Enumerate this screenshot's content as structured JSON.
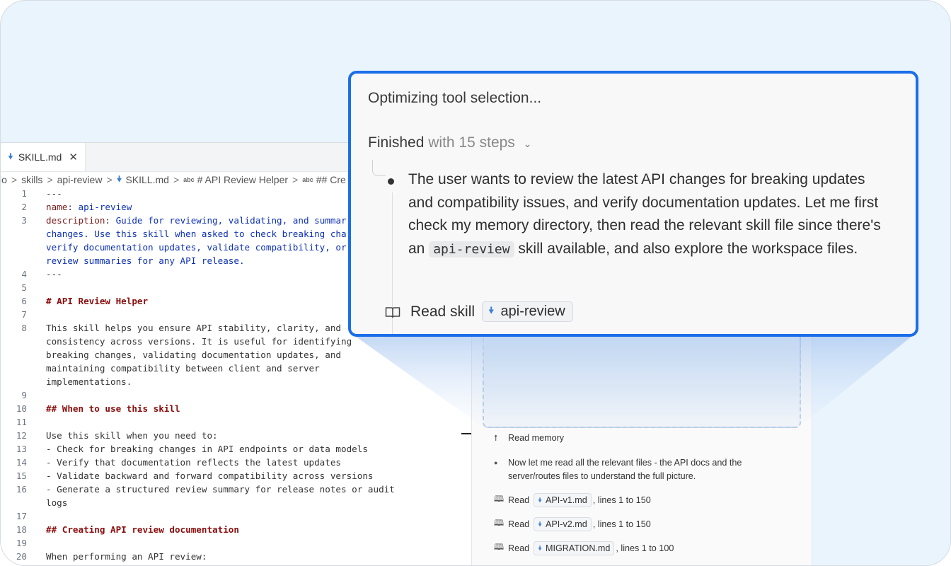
{
  "editor": {
    "tab_label": "SKILL.md",
    "tab_close": "✕",
    "breadcrumb": {
      "items": [
        "io",
        "skills",
        "api-review",
        "SKILL.md",
        "# API Review Helper",
        "## Cre"
      ],
      "sep": ">",
      "abc": "abc"
    },
    "lines": [
      {
        "n": "1",
        "t": "---"
      },
      {
        "n": "2",
        "k": "name",
        "v": "api-review"
      },
      {
        "n": "3",
        "k": "description",
        "v": "Guide for reviewing, validating, and summar"
      },
      {
        "n": "",
        "t": "changes. Use this skill when asked to check breaking cha",
        "cls": "c-blue"
      },
      {
        "n": "",
        "t": "verify documentation updates, validate compatibility, or",
        "cls": "c-blue"
      },
      {
        "n": "",
        "t": "review summaries for any API release.",
        "cls": "c-blue"
      },
      {
        "n": "4",
        "t": "---"
      },
      {
        "n": "5",
        "t": ""
      },
      {
        "n": "6",
        "t": "# API Review Helper",
        "cls": "c-head"
      },
      {
        "n": "7",
        "t": ""
      },
      {
        "n": "8",
        "t": "This skill helps you ensure API stability, clarity, and"
      },
      {
        "n": "",
        "t": "consistency across versions. It is useful for identifying"
      },
      {
        "n": "",
        "t": "breaking changes, validating documentation updates, and"
      },
      {
        "n": "",
        "t": "maintaining compatibility between client and server"
      },
      {
        "n": "",
        "t": "implementations."
      },
      {
        "n": "9",
        "t": ""
      },
      {
        "n": "10",
        "t": "## When to use this skill",
        "cls": "c-head"
      },
      {
        "n": "11",
        "t": ""
      },
      {
        "n": "12",
        "t": "Use this skill when you need to:"
      },
      {
        "n": "13",
        "t": "- Check for breaking changes in API endpoints or data models"
      },
      {
        "n": "14",
        "t": "- Verify that documentation reflects the latest updates"
      },
      {
        "n": "15",
        "t": "- Validate backward and forward compatibility across versions"
      },
      {
        "n": "16",
        "t": "- Generate a structured review summary for release notes or audit"
      },
      {
        "n": "",
        "t": "logs"
      },
      {
        "n": "17",
        "t": ""
      },
      {
        "n": "18",
        "t": "## Creating API review documentation",
        "cls": "c-head"
      },
      {
        "n": "19",
        "t": ""
      },
      {
        "n": "20",
        "t": "When performing an API review:"
      }
    ]
  },
  "chat_small": {
    "read_memory": "Read memory",
    "message": "Now let me read all the relevant files - the API docs and the",
    "message_2": "server/routes files to understand the full picture.",
    "read_label": "Read",
    "reads": [
      {
        "file": "API-v1.md",
        "range": ", lines 1 to 150"
      },
      {
        "file": "API-v2.md",
        "range": ", lines 1 to 150"
      },
      {
        "file": "MIGRATION.md",
        "range": ", lines 1 to 100"
      }
    ]
  },
  "popup": {
    "title": "Optimizing tool selection...",
    "finished": "Finished",
    "steps": "with 15 steps",
    "text_before": "The user wants to review the latest API changes for breaking updates and compatibility issues, and verify documentation updates. Let me first check my memory directory, then read the relevant skill file since there's an ",
    "inline_code": "api-review",
    "text_after": " skill available, and also explore the workspace files.",
    "read_skill": "Read skill",
    "skill_chip": "api-review"
  },
  "colors": {
    "accent": "#1b6ee8",
    "md_icon": "#3b7fd4",
    "yaml_value": "#0d31b5",
    "heading": "#8b0d0d",
    "background": "#eaf4fd"
  },
  "icons": [
    "markdown-file-icon",
    "close-icon",
    "chevron-down-icon",
    "book-icon",
    "memory-icon",
    "bullet-icon"
  ]
}
